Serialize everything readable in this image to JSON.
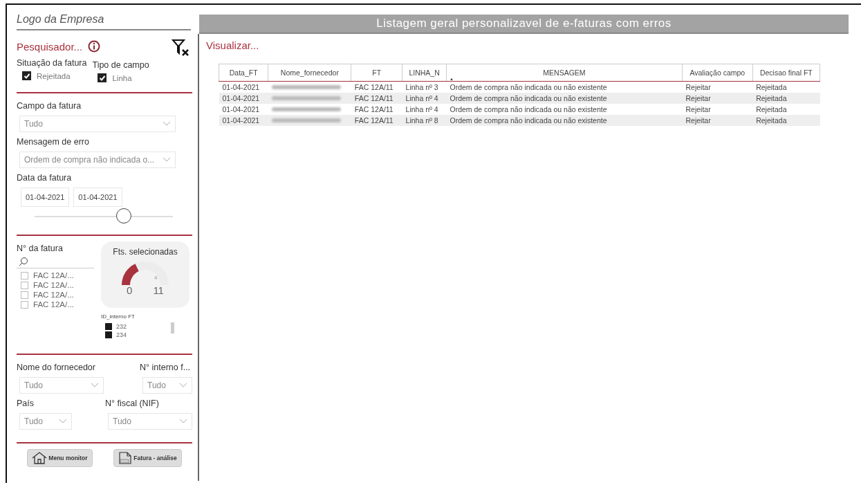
{
  "logo": {
    "text": "Logo da Empresa"
  },
  "title": "Listagem geral personalizavel de e-faturas com erros",
  "search_panel": {
    "title": "Pesquisador...",
    "filters": [
      {
        "label": "Situação da fatura",
        "option": "Rejeitada",
        "checked": true
      },
      {
        "label": "Tipo de campo",
        "option": "Linha",
        "checked": true
      }
    ],
    "dropdowns": [
      {
        "label": "Campo da fatura",
        "value": "Tudo"
      },
      {
        "label": "Mensagem de erro",
        "value": "Ordem de compra não indicada o..."
      }
    ],
    "date": {
      "label": "Data da fatura",
      "from": "01-04-2021",
      "to": "01-04-2021",
      "level": 0.65
    },
    "invoice_list": {
      "label": "N° da fatura",
      "items": [
        {
          "text": "FAC 12A/...",
          "checked": false
        },
        {
          "text": "FAC 12A/...",
          "checked": false
        },
        {
          "text": "FAC 12A/...",
          "checked": false
        },
        {
          "text": "FAC 12A/...",
          "checked": false
        }
      ]
    },
    "gauge": {
      "title": "Fts. selecionadas",
      "value": "4",
      "min": "0",
      "max": "11"
    },
    "legend": {
      "title": "ID_interno FT",
      "items": [
        "232",
        "234"
      ]
    },
    "bottom_dropdowns": [
      [
        {
          "label": "Nome do fornecedor",
          "value": "Tudo"
        },
        {
          "label": "N° interno f...",
          "value": "Tudo"
        }
      ],
      [
        {
          "label": "País",
          "value": "Tudo"
        },
        {
          "label": "N° fiscal (NIF)",
          "value": "Tudo"
        }
      ]
    ],
    "buttons": [
      {
        "label": "Menu monitor",
        "kind": "home"
      },
      {
        "label": "Fatura - análise",
        "kind": "document"
      }
    ]
  },
  "view": {
    "title": "Visualizar...",
    "table": {
      "columns": [
        "Data_FT",
        "Nome_fornecedor",
        "FT",
        "LINHA_N",
        "MENSAGEM",
        "Avaliação campo",
        "Decisao final FT"
      ],
      "sort_indicator": "▲",
      "rows": [
        {
          "date": "01-04-2021",
          "supplier_redacted": true,
          "ft": "FAC 12A/11",
          "line": "Linha nº 3",
          "message": "Ordem de compra não indicada ou não existente",
          "evaluation": "Rejeitar",
          "decision": "Rejeitada"
        },
        {
          "date": "01-04-2021",
          "supplier_redacted": true,
          "ft": "FAC 12A/11",
          "line": "Linha nº 4",
          "message": "Ordem de compra não indicada ou não existente",
          "evaluation": "Rejeitar",
          "decision": "Rejeitada"
        },
        {
          "date": "01-04-2021",
          "supplier_redacted": true,
          "ft": "FAC 12A/11",
          "line": "Linha nº 4",
          "message": "Ordem de compra não indicada ou não existente",
          "evaluation": "Rejeitar",
          "decision": "Rejeitada"
        },
        {
          "date": "01-04-2021",
          "supplier_redacted": true,
          "ft": "FAC 12A/11",
          "line": "Linha nº 8",
          "message": "Ordem de compra não indicada ou não existente",
          "evaluation": "Rejeitar",
          "decision": "Rejeitada"
        }
      ]
    }
  }
}
